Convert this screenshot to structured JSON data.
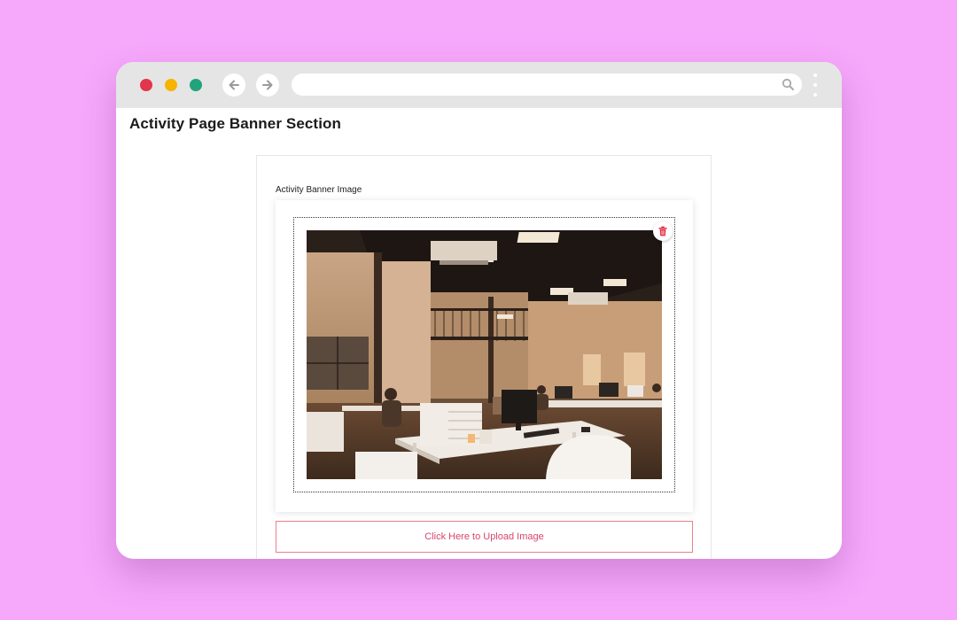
{
  "browser": {
    "url": "",
    "traffic_lights": {
      "close": "#e3354b",
      "minimize": "#f4b400",
      "zoom": "#22a37c"
    },
    "icons": [
      "back-arrow-icon",
      "forward-arrow-icon",
      "search-icon",
      "kebab-menu-icon"
    ]
  },
  "page": {
    "title": "Activity Page Banner Section"
  },
  "banner_field": {
    "label": "Activity Banner Image",
    "image_description_icon": "uploaded-office-photo",
    "delete_icon": "trash-icon",
    "delete_color": "#e3354b",
    "upload_button_label": "Click Here to Upload Image",
    "accent_color": "#d9466a"
  }
}
